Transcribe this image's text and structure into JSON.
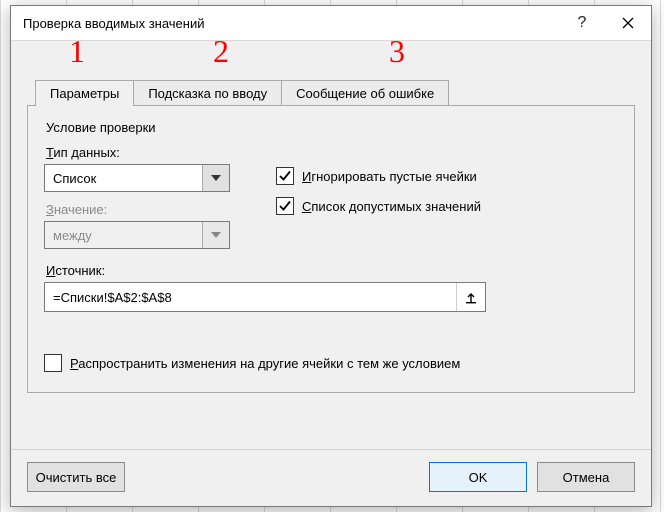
{
  "annotations": {
    "a1": "1",
    "a2": "2",
    "a3": "3"
  },
  "dialog_title": "Проверка вводимых значений",
  "tabs": [
    {
      "label": "Параметры",
      "active": true
    },
    {
      "label": "Подсказка по вводу",
      "active": false
    },
    {
      "label": "Сообщение об ошибке",
      "active": false
    }
  ],
  "group": {
    "title": "Условие проверки",
    "type_label_html": "<u>Т</u>ип данных:",
    "type_value": "Список",
    "value_label_html": "<u>З</u>начение:",
    "value_value": "между",
    "source_label_html": "<u>И</u>сточник:",
    "source_value": "=Списки!$A$2:$A$8",
    "ignore_blank_html": "<u>И</u>гнорировать пустые ячейки",
    "in_cell_dropdown_html": "<u>С</u>писок допустимых значений",
    "propagate_html": "<u>Р</u>аспространить изменения на другие ячейки с тем же условием"
  },
  "buttons": {
    "clear": "Очистить все",
    "ok": "OK",
    "cancel": "Отмена"
  },
  "checked": {
    "ignore_blank": true,
    "in_cell_dropdown": true,
    "propagate": false
  }
}
